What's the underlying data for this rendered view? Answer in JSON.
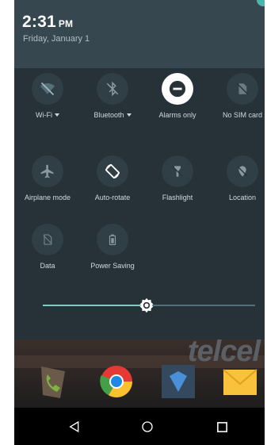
{
  "status": {
    "time": "2:31",
    "ampm": "PM",
    "date": "Friday, January 1"
  },
  "tiles": [
    {
      "label": "Wi-Fi",
      "icon": "wifi-off-icon",
      "has_dropdown": true,
      "active": false
    },
    {
      "label": "Bluetooth",
      "icon": "bluetooth-off-icon",
      "has_dropdown": true,
      "active": false
    },
    {
      "label": "Alarms only",
      "icon": "do-not-disturb-icon",
      "has_dropdown": false,
      "active": true
    },
    {
      "label": "No SIM card",
      "icon": "no-sim-icon",
      "has_dropdown": false,
      "active": false
    },
    {
      "label": "Airplane mode",
      "icon": "airplane-icon",
      "has_dropdown": false,
      "active": false
    },
    {
      "label": "Auto-rotate",
      "icon": "auto-rotate-icon",
      "has_dropdown": false,
      "active": true
    },
    {
      "label": "Flashlight",
      "icon": "flashlight-off-icon",
      "has_dropdown": false,
      "active": false
    },
    {
      "label": "Location",
      "icon": "location-off-icon",
      "has_dropdown": false,
      "active": false
    },
    {
      "label": "Data",
      "icon": "data-off-icon",
      "has_dropdown": false,
      "active": false
    },
    {
      "label": "Power Saving",
      "icon": "battery-icon",
      "has_dropdown": false,
      "active": false
    }
  ],
  "brightness": {
    "level": 0.49
  },
  "wallpaper_text": "telcel",
  "dock": [
    "phone-icon",
    "chrome-icon",
    "telcel-app-icon",
    "email-icon"
  ],
  "navigation": [
    "back-icon",
    "home-icon",
    "recents-icon"
  ],
  "colors": {
    "panel": "#263238",
    "header": "#37474f",
    "accent": "#80cbc4",
    "tile_bg": "#303e45",
    "label": "#cfd8dc"
  }
}
